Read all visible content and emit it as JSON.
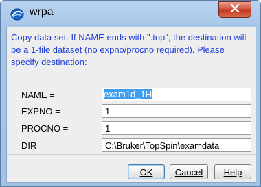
{
  "window": {
    "title": "wrpa",
    "close_glyph": "X"
  },
  "dialog": {
    "message": "Copy data set. If NAME ends with \".top\", the destination will be a 1-file dataset (no expno/procno required). Please specify destination:",
    "fields": [
      {
        "label": "NAME =",
        "value": "exam1d_1H"
      },
      {
        "label": "EXPNO =",
        "value": "1"
      },
      {
        "label": "PROCNO =",
        "value": "1"
      },
      {
        "label": "DIR =",
        "value": "C:\\Bruker\\TopSpin\\examdata"
      }
    ]
  },
  "buttons": {
    "ok": "OK",
    "cancel": "Cancel",
    "help": "Help"
  },
  "colors": {
    "message_text": "#1f3fd8",
    "selection": "#3d9ef0"
  }
}
